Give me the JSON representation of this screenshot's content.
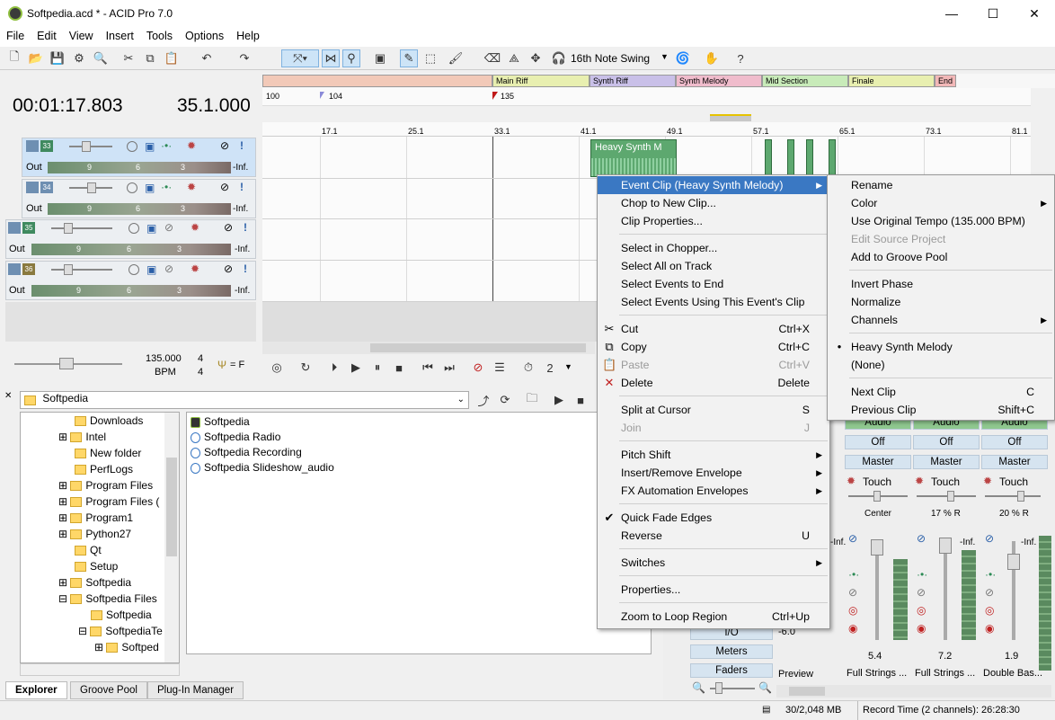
{
  "window": {
    "title": "Softpedia.acd * - ACID Pro 7.0",
    "minimize": "—",
    "maximize": "☐",
    "close": "✕"
  },
  "menu": [
    "File",
    "Edit",
    "View",
    "Insert",
    "Tools",
    "Options",
    "Help"
  ],
  "toolbar": {
    "swing_label": "16th Note Swing"
  },
  "timing": {
    "time": "00:01:17.803",
    "beat": "35.1.000"
  },
  "markers": [
    "Main Riff",
    "Synth Riff",
    "Synth Melody",
    "Mid Section",
    "Finale",
    "End"
  ],
  "tempo_markers": [
    "100",
    "104",
    "135"
  ],
  "ruler_ticks": [
    "17.1",
    "25.1",
    "33.1",
    "41.1",
    "49.1",
    "57.1",
    "65.1",
    "73.1",
    "81.1"
  ],
  "tracks": [
    {
      "num": "33",
      "out": "Out",
      "m1": "9",
      "m2": "6",
      "m3": "3",
      "inf": "-Inf."
    },
    {
      "num": "34",
      "out": "Out",
      "m1": "9",
      "m2": "6",
      "m3": "3",
      "inf": "-Inf."
    },
    {
      "num": "35",
      "out": "Out",
      "m1": "9",
      "m2": "6",
      "m3": "3",
      "inf": "-Inf."
    },
    {
      "num": "36",
      "out": "Out",
      "m1": "9",
      "m2": "6",
      "m3": "3",
      "inf": "-Inf."
    }
  ],
  "clip": {
    "label": "Heavy Synth M"
  },
  "tempo": {
    "bpm": "135.000",
    "bpm_label": "BPM",
    "sig_top": "4",
    "sig_bottom": "4",
    "key": "= F"
  },
  "explorer": {
    "path": "Softpedia",
    "tree": [
      "Downloads",
      "Intel",
      "New folder",
      "PerfLogs",
      "Program Files",
      "Program Files (",
      "Program1",
      "Python27",
      "Qt",
      "Setup",
      "Softpedia",
      "Softpedia Files",
      "Softpedia",
      "SoftpediaTe",
      "Softped"
    ],
    "files": [
      "Softpedia",
      "Softpedia Radio",
      "Softpedia Recording",
      "Softpedia Slideshow_audio"
    ]
  },
  "bottom_tabs": [
    "Explorer",
    "Groove Pool",
    "Plug-In Manager"
  ],
  "mixer": {
    "side_buttons": [
      "I/O",
      "Meters",
      "Faders"
    ],
    "strips": [
      {
        "audio": "Audio",
        "off": "Off",
        "master": "Master",
        "touch": "Touch",
        "pan": "Center",
        "db": "5.4",
        "name": "Full Strings ..."
      },
      {
        "audio": "Audio",
        "off": "Off",
        "master": "Master",
        "touch": "Touch",
        "pan": "17 % R",
        "db": "7.2",
        "name": "Full Strings ..."
      },
      {
        "audio": "Audio",
        "off": "Off",
        "master": "Master",
        "touch": "Touch",
        "pan": "20 % R",
        "db": "1.9",
        "name": "Double Bas..."
      }
    ],
    "preview_db": "-6.0",
    "preview": "Preview",
    "inf": "-Inf."
  },
  "status": {
    "memory": "30/2,048 MB",
    "record": "Record Time (2 channels): 26:28:30"
  },
  "context_menu": {
    "items": [
      {
        "label": "Event Clip (Heavy Synth Melody)",
        "sub": true,
        "hl": true
      },
      {
        "label": "Chop to New Clip..."
      },
      {
        "label": "Clip Properties..."
      },
      {
        "sep": true
      },
      {
        "label": "Select in Chopper..."
      },
      {
        "label": "Select All on Track"
      },
      {
        "label": "Select Events to End"
      },
      {
        "label": "Select Events Using This Event's Clip"
      },
      {
        "sep": true
      },
      {
        "label": "Cut",
        "sc": "Ctrl+X",
        "icon": "✂"
      },
      {
        "label": "Copy",
        "sc": "Ctrl+C",
        "icon": "⧉"
      },
      {
        "label": "Paste",
        "sc": "Ctrl+V",
        "icon": "📋",
        "dis": true
      },
      {
        "label": "Delete",
        "sc": "Delete",
        "icon": "✕"
      },
      {
        "sep": true
      },
      {
        "label": "Split at Cursor",
        "sc": "S"
      },
      {
        "label": "Join",
        "sc": "J",
        "dis": true
      },
      {
        "sep": true
      },
      {
        "label": "Pitch Shift",
        "sub": true
      },
      {
        "label": "Insert/Remove Envelope",
        "sub": true
      },
      {
        "label": "FX Automation Envelopes",
        "sub": true
      },
      {
        "sep": true
      },
      {
        "label": "Quick Fade Edges",
        "icon": "✔"
      },
      {
        "label": "Reverse",
        "sc": "U"
      },
      {
        "sep": true
      },
      {
        "label": "Switches",
        "sub": true
      },
      {
        "sep": true
      },
      {
        "label": "Properties..."
      },
      {
        "sep": true
      },
      {
        "label": "Zoom to Loop Region",
        "sc": "Ctrl+Up"
      }
    ],
    "submenu": [
      {
        "label": "Rename"
      },
      {
        "label": "Color",
        "sub": true
      },
      {
        "label": "Use Original Tempo (135.000 BPM)"
      },
      {
        "label": "Edit Source Project",
        "dis": true
      },
      {
        "label": "Add to Groove Pool"
      },
      {
        "sep": true
      },
      {
        "label": "Invert Phase"
      },
      {
        "label": "Normalize"
      },
      {
        "label": "Channels",
        "sub": true
      },
      {
        "sep": true
      },
      {
        "label": "Heavy Synth Melody",
        "icon": "●"
      },
      {
        "label": "(None)"
      },
      {
        "sep": true
      },
      {
        "label": "Next Clip",
        "sc": "C"
      },
      {
        "label": "Previous Clip",
        "sc": "Shift+C"
      }
    ]
  }
}
